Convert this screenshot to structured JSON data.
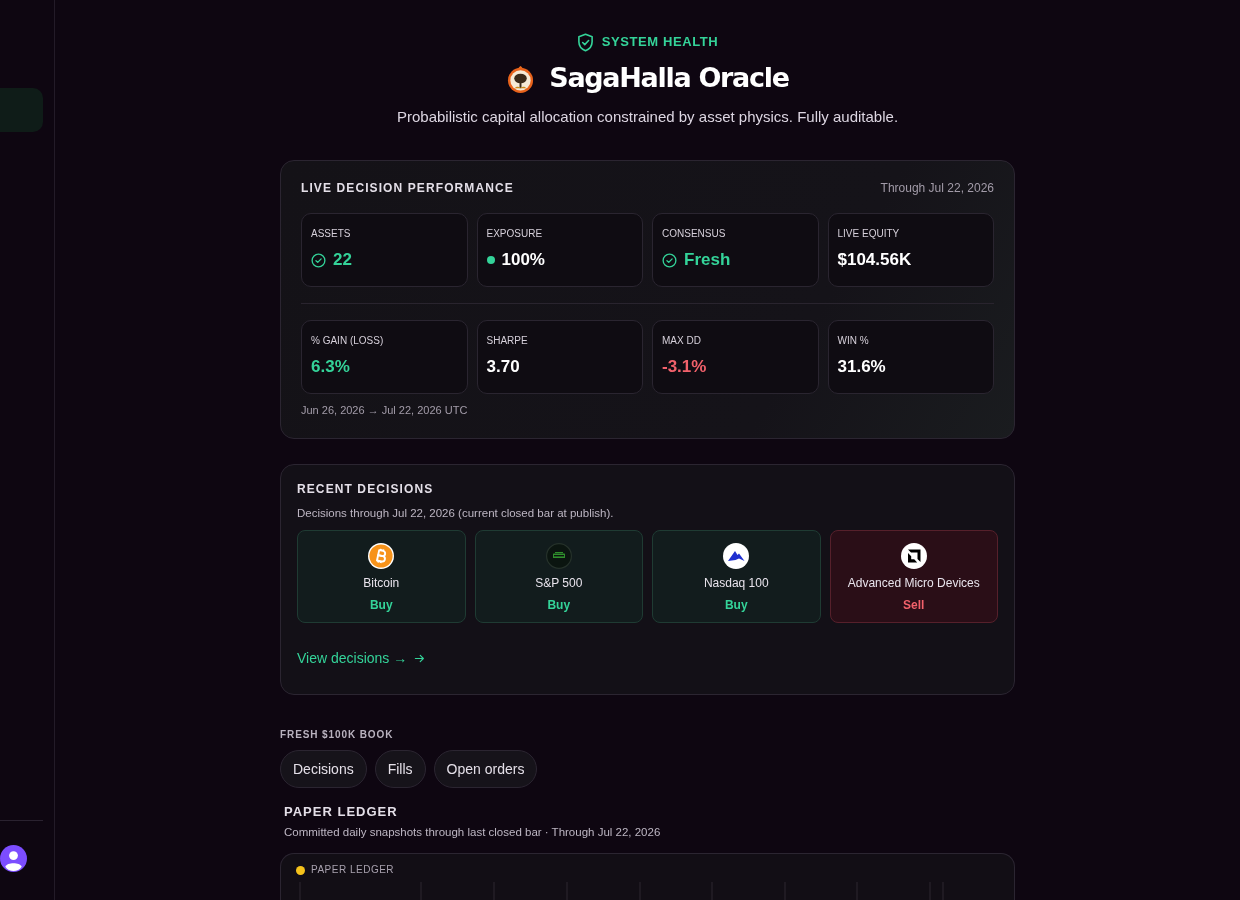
{
  "sidebar": {
    "items": [
      {
        "selected": true
      }
    ]
  },
  "header": {
    "badge": "SYSTEM HEALTH",
    "title": "SagaHalla Oracle",
    "subtitle": "Probabilistic capital allocation constrained by asset physics. Fully auditable."
  },
  "performance": {
    "title": "LIVE DECISION PERFORMANCE",
    "through": "Through Jul 22, 2026",
    "stat_rows": [
      [
        {
          "label": "ASSETS",
          "value": "22",
          "kind": "check",
          "color": "#34d399"
        },
        {
          "label": "EXPOSURE",
          "value": "100%",
          "kind": "dot",
          "color": "#ffffff"
        },
        {
          "label": "CONSENSUS",
          "value": "Fresh",
          "kind": "check",
          "color": "#34d399"
        },
        {
          "label": "LIVE EQUITY",
          "value": "$104.56K",
          "kind": "plain",
          "color": "#ffffff"
        }
      ],
      [
        {
          "label": "% GAIN (LOSS)",
          "value": "6.3%",
          "kind": "plain",
          "color": "#34d399"
        },
        {
          "label": "SHARPE",
          "value": "3.70",
          "kind": "plain",
          "color": "#ffffff"
        },
        {
          "label": "MAX DD",
          "value": "-3.1%",
          "kind": "plain",
          "color": "#f2616b"
        },
        {
          "label": "WIN %",
          "value": "31.6%",
          "kind": "plain",
          "color": "#ffffff"
        }
      ]
    ],
    "range": "Jun 26, 2026 → Jul 22, 2026 UTC"
  },
  "recent": {
    "title": "RECENT DECISIONS",
    "subtitle": "Decisions through Jul 22, 2026 (current closed bar at publish).",
    "decisions": [
      {
        "name": "Bitcoin",
        "action": "Buy",
        "kind": "buy"
      },
      {
        "name": "S&P 500",
        "action": "Buy",
        "kind": "buy"
      },
      {
        "name": "Nasdaq 100",
        "action": "Buy",
        "kind": "buy"
      },
      {
        "name": "Advanced Micro Devices",
        "action": "Sell",
        "kind": "sell"
      }
    ],
    "link": "View decisions →"
  },
  "book": {
    "label": "FRESH $100K BOOK",
    "buttons": [
      "Decisions",
      "Fills",
      "Open orders"
    ]
  },
  "ledger": {
    "title": "PAPER LEDGER",
    "subtitle": "Committed daily snapshots through last closed bar · Through Jul 22, 2026",
    "legend": [
      {
        "label": "PAPER LEDGER",
        "color": "#f5c21b"
      }
    ]
  }
}
